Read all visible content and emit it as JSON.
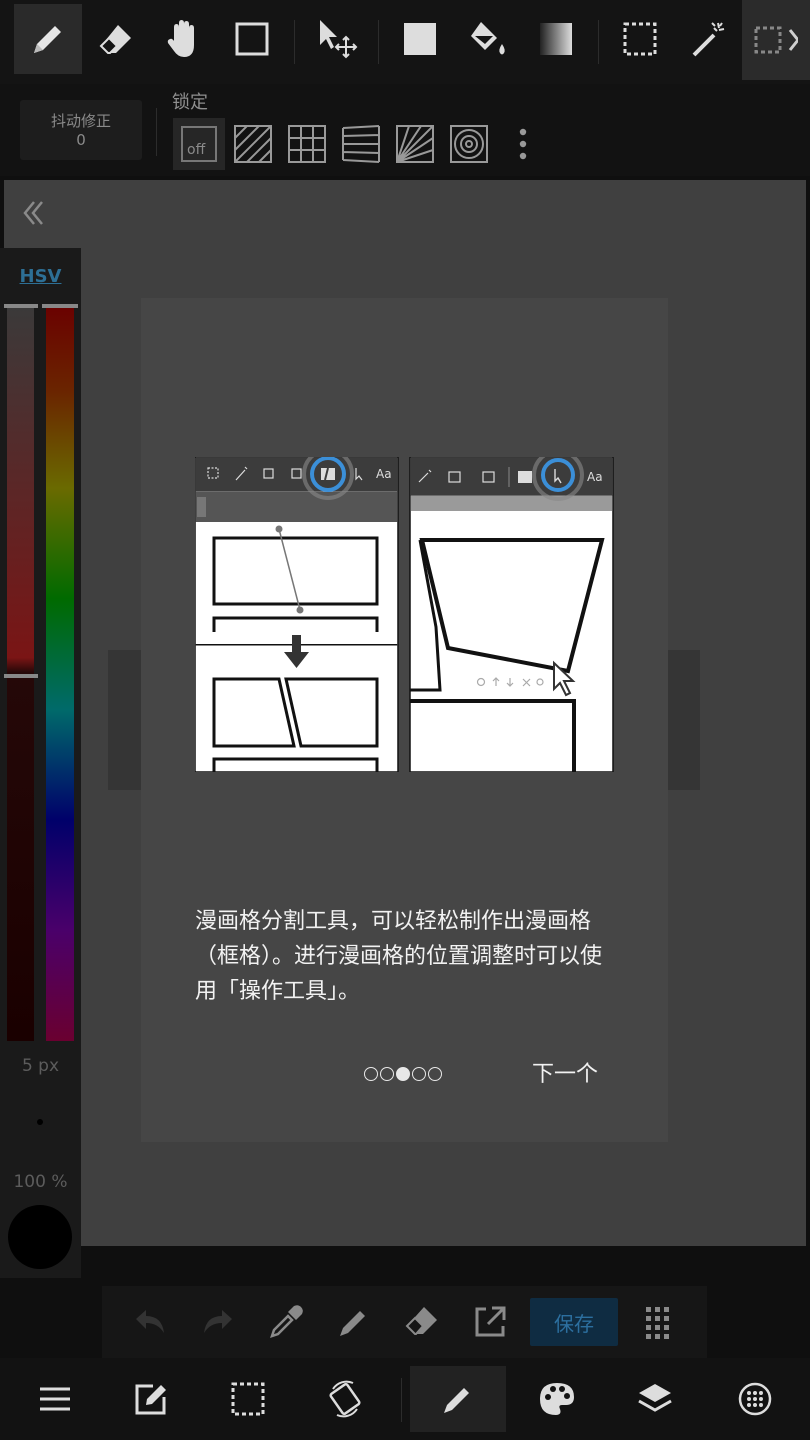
{
  "toolbar": {
    "tools": [
      "pen-tool",
      "eraser-tool",
      "hand-tool",
      "selection-rect-tool",
      "move-tool",
      "fill-rect-tool",
      "bucket-tool",
      "gradient-tool",
      "lasso-select-tool",
      "magic-wand-tool",
      "select-pen-tool"
    ]
  },
  "sub_toolbar": {
    "stabilizer_label": "抖动修正",
    "stabilizer_value": "0",
    "lock_label": "锁定",
    "snap_off_label": "off"
  },
  "color_panel": {
    "mode_label": "HSV",
    "brush_size": "5 px",
    "opacity": "100 %",
    "current_color": "#000000"
  },
  "quick_bar": {
    "save_label": "保存"
  },
  "tutorial": {
    "description": "漫画格分割工具，可以轻松制作出漫画格（框格）。进行漫画格的位置调整时可以使用「操作工具」。",
    "next_label": "下一个",
    "page_count": 5,
    "current_page": 3
  },
  "colors": {
    "accent": "#2c6f9f",
    "dialog_bg": "#464646",
    "canvas_bg": "#404040",
    "highlight_ring": "#3b8fd8"
  }
}
